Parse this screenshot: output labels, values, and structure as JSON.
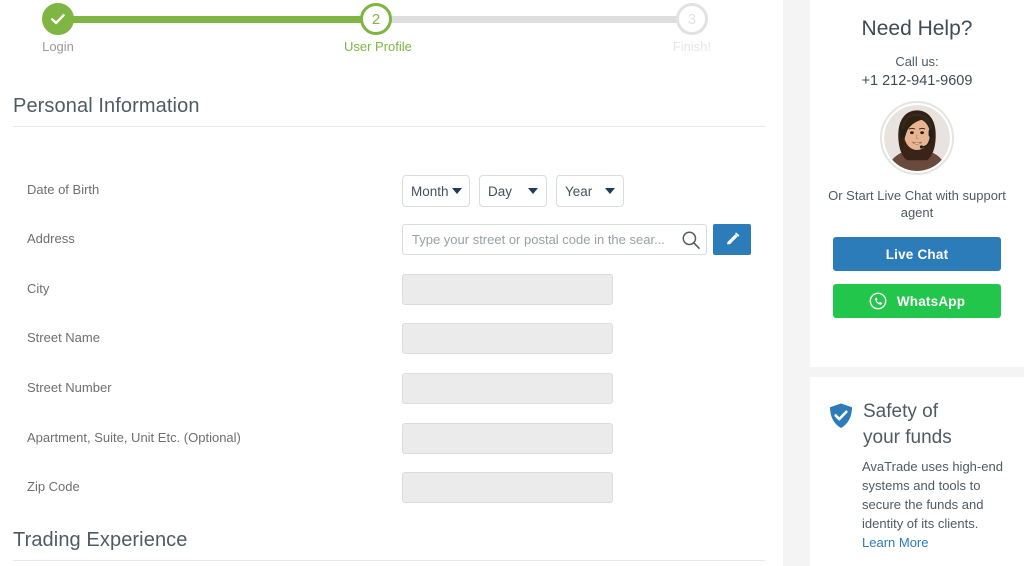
{
  "stepper": {
    "steps": [
      {
        "label": "Login",
        "badge": "check",
        "state": "done"
      },
      {
        "label": "User Profile",
        "badge": "2",
        "state": "current"
      },
      {
        "label": "Finish!",
        "badge": "3",
        "state": "todo"
      }
    ]
  },
  "sections": {
    "personal": {
      "title": "Personal Information"
    },
    "trading": {
      "title": "Trading Experience"
    }
  },
  "form": {
    "date_of_birth": {
      "label": "Date of Birth",
      "month": "Month",
      "day": "Day",
      "year": "Year"
    },
    "address": {
      "label": "Address",
      "placeholder": "Type your street or postal code in the sear...",
      "value": ""
    },
    "city": {
      "label": "City",
      "value": ""
    },
    "street_name": {
      "label": "Street Name",
      "value": ""
    },
    "street_number": {
      "label": "Street Number",
      "value": ""
    },
    "apartment": {
      "label": "Apartment, Suite, Unit Etc. (Optional)",
      "value": ""
    },
    "zip_code": {
      "label": "Zip Code",
      "value": ""
    }
  },
  "sidebar": {
    "help": {
      "title": "Need Help?",
      "call_us": "Call us:",
      "phone": "+1 212-941-9609",
      "chat_prompt": "Or Start Live Chat with support agent",
      "live_chat_label": "Live Chat",
      "whatsapp_label": "WhatsApp"
    },
    "safety": {
      "title_line1": "Safety of",
      "title_line2": "your funds",
      "body": "AvaTrade uses high-end systems and tools to secure the funds and identity of its clients.",
      "link": "Learn More"
    }
  },
  "colors": {
    "green": "#7eb543",
    "blue": "#2c7cba",
    "whatsapp_green": "#22c64a",
    "track_inactive": "#dedede",
    "label_gray": "#6f6f6f",
    "heading_gray": "#4f5b62",
    "input_fill": "#ebebeb"
  }
}
